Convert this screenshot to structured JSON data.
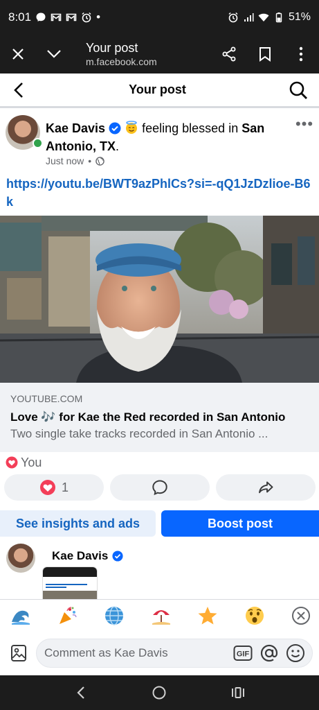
{
  "status_bar": {
    "time": "8:01",
    "battery": "51%",
    "dot": "•"
  },
  "browser": {
    "title": "Your post",
    "url": "m.facebook.com"
  },
  "header": {
    "title": "Your post"
  },
  "post": {
    "author": "Kae Davis",
    "feeling_text": " feeling blessed in ",
    "location": "San Antonio, TX",
    "period": ".",
    "time": "Just now",
    "separator": "•",
    "more": "•••",
    "link": "https://youtu.be/BWT9azPhlCs?si=-qQ1JzDzlioe-B6k"
  },
  "preview": {
    "domain": "YOUTUBE.COM",
    "title": "Love 🎶 for Kae the Red recorded in San Antonio",
    "description": "Two single take tracks recorded in San Antonio ..."
  },
  "reactions": {
    "summary": "You",
    "like_count": "1"
  },
  "cta": {
    "insights": "See insights and ads",
    "boost": "Boost post"
  },
  "comment_preview": {
    "name": "Kae Davis"
  },
  "emoji_bar": [
    "🌊",
    "🎉",
    "🌐",
    "🏖️",
    "⭐",
    "😲"
  ],
  "composer": {
    "placeholder": "Comment as Kae Davis",
    "gif": "GIF"
  },
  "colors": {
    "accent": "#0866ff",
    "link": "#1565c0",
    "online": "#31a24c",
    "heart": "#f33e58"
  }
}
